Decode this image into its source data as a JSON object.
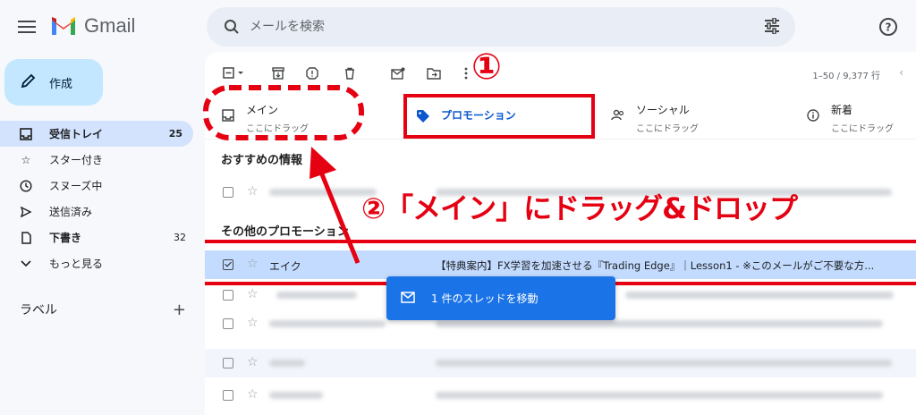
{
  "app": {
    "name": "Gmail"
  },
  "search": {
    "placeholder": "メールを検索"
  },
  "sidebar": {
    "compose_label": "作成",
    "items": [
      {
        "label": "受信トレイ",
        "count": "25",
        "icon": "inbox-icon"
      },
      {
        "label": "スター付き",
        "count": "",
        "icon": "star-icon"
      },
      {
        "label": "スヌーズ中",
        "count": "",
        "icon": "clock-icon"
      },
      {
        "label": "送信済み",
        "count": "",
        "icon": "send-icon"
      },
      {
        "label": "下書き",
        "count": "32",
        "icon": "draft-icon"
      },
      {
        "label": "もっと見る",
        "count": "",
        "icon": "chevron-down-icon"
      }
    ],
    "labels_heading": "ラベル",
    "labels_add": "+"
  },
  "toolbar": {
    "page_info": "1–50 / 9,377 行"
  },
  "tabs": [
    {
      "title": "メイン",
      "subtitle": "ここにドラッグ",
      "icon": "inbox-icon"
    },
    {
      "title": "プロモーション",
      "subtitle": "",
      "icon": "tag-icon"
    },
    {
      "title": "ソーシャル",
      "subtitle": "ここにドラッグ",
      "icon": "people-icon"
    },
    {
      "title": "新着",
      "subtitle": "ここにドラッグ",
      "icon": "info-icon"
    }
  ],
  "sections": {
    "recommended": "おすすめの情報",
    "other": "その他のプロモーション"
  },
  "selected_email": {
    "sender": "エイク",
    "subject": "【特典案内】FX学習を加速させる『Trading Edge』｜Lesson1 - ※このメールがご不要な方..."
  },
  "toast": {
    "text": "1 件のスレッドを移動"
  },
  "annotations": {
    "step1": "①",
    "step2": "②「メイン」にドラッグ&ドロップ",
    "color": "#e50012"
  },
  "colors": {
    "accent": "#0b57d0",
    "compose_bg": "#c2e7ff",
    "selected_row": "#c2dbff",
    "toast_bg": "#1b73e8"
  }
}
